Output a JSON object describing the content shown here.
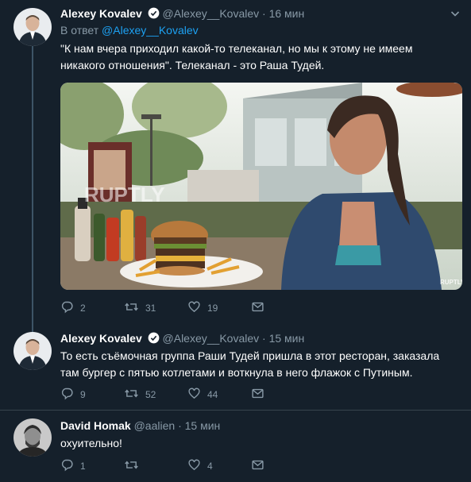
{
  "tweets": [
    {
      "name": "Alexey Kovalev",
      "handle": "@Alexey__Kovalev",
      "time": "16 мин",
      "reply_prefix": "В ответ",
      "reply_to": "@Alexey__Kovalev",
      "text": "\"К нам вчера приходил какой-то телеканал, но мы к этому не имеем никакого отношения\". Телеканал - это Раша Тудей.",
      "media_watermark": "RUPTLY",
      "media_corner": "RUPTLY",
      "replies": "2",
      "retweets": "31",
      "likes": "19"
    },
    {
      "name": "Alexey Kovalev",
      "handle": "@Alexey__Kovalev",
      "time": "15 мин",
      "text": "То есть съёмочная группа Раши Тудей пришла в этот ресторан, заказала там бургер с пятью котлетами и воткнула в него флажок с Путиным.",
      "replies": "9",
      "retweets": "52",
      "likes": "44"
    },
    {
      "name": "David Homak",
      "handle": "@aalien",
      "time": "15 мин",
      "text": "охуительно!",
      "replies": "1",
      "retweets": "",
      "likes": "4"
    }
  ],
  "separator": "·",
  "colors": {
    "background": "#15202b",
    "accent": "#1da1f2",
    "muted": "#8899a6",
    "divider": "#38444d"
  },
  "icons": [
    "verified-icon",
    "chevron-down-icon",
    "reply-icon",
    "retweet-icon",
    "like-icon",
    "share-icon"
  ]
}
